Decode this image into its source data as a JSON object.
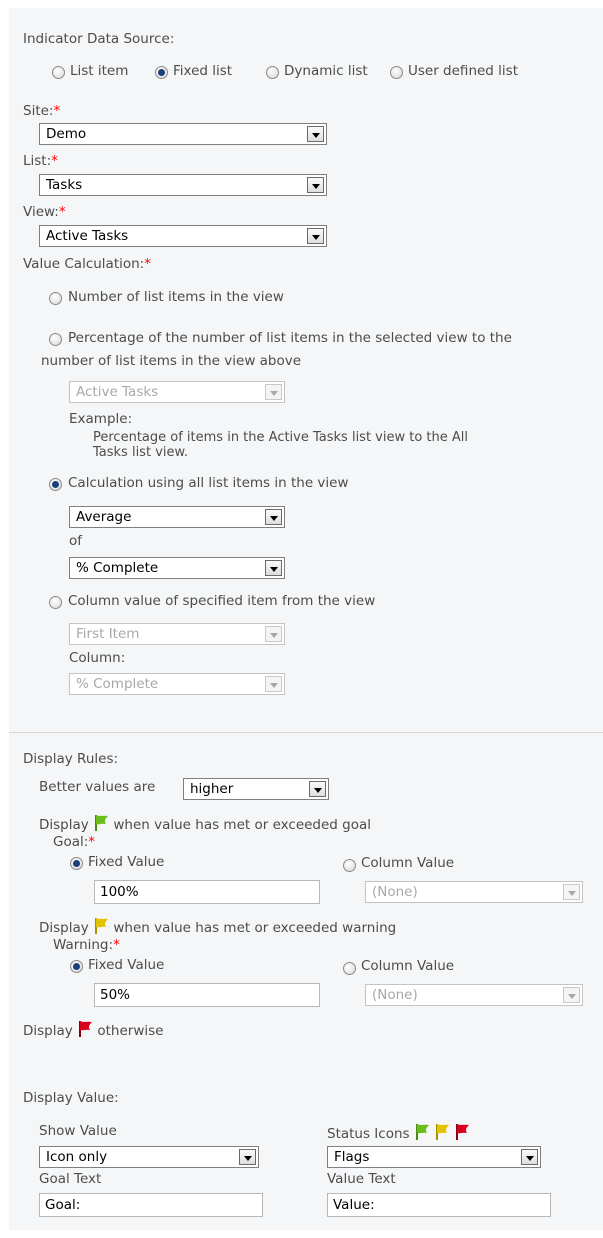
{
  "data_source": {
    "label": "Indicator Data Source:",
    "options": [
      "List item",
      "Fixed list",
      "Dynamic list",
      "User defined list"
    ],
    "selected": "Fixed list"
  },
  "site": {
    "label": "Site:",
    "value": "Demo"
  },
  "list": {
    "label": "List:",
    "value": "Tasks"
  },
  "view": {
    "label": "View:",
    "value": "Active Tasks"
  },
  "value_calc": {
    "label": "Value Calculation:",
    "opt_number": "Number of list items in the view",
    "opt_percentage_line1": "Percentage of the number of list items in the selected view to the",
    "opt_percentage_line2": "number of list items in the view above",
    "percentage_view": "Active Tasks",
    "example_label": "Example:",
    "example_line1": "Percentage of items in the Active Tasks list view to the All",
    "example_line2": "Tasks list view.",
    "opt_calculation": "Calculation using all list items in the view",
    "calc_function": "Average",
    "of_label": "of",
    "calc_column": "% Complete",
    "opt_column_value": "Column value of specified item from the view",
    "item_select": "First Item",
    "column_label": "Column:",
    "column_select": "% Complete",
    "selected": "Calculation using all list items in the view"
  },
  "display_rules": {
    "label": "Display Rules:",
    "better_label": "Better values are",
    "better_value": "higher",
    "display_word": "Display",
    "goal_text": "when value has met or exceeded goal",
    "goal_label": "Goal:",
    "fixed_value_label": "Fixed Value",
    "column_value_label": "Column Value",
    "goal_value": "100%",
    "goal_column": "(None)",
    "warning_text": "when value has met or exceeded warning",
    "warning_label": "Warning:",
    "warning_value": "50%",
    "warning_column": "(None)",
    "otherwise_text": "otherwise",
    "goal_icon": "green-flag-icon",
    "warning_icon": "yellow-flag-icon",
    "otherwise_icon": "red-flag-icon"
  },
  "display_value": {
    "label": "Display Value:",
    "show_value_label": "Show Value",
    "show_value": "Icon only",
    "status_icons_label": "Status Icons",
    "status_icons": "Flags",
    "goal_text_label": "Goal Text",
    "goal_text_value": "Goal:",
    "value_text_label": "Value Text",
    "value_text_value": "Value:"
  },
  "required_marker": "*",
  "colors": {
    "green": "#6bbd1c",
    "yellow": "#e2c300",
    "red": "#d8001c",
    "required": "#ff0000"
  }
}
